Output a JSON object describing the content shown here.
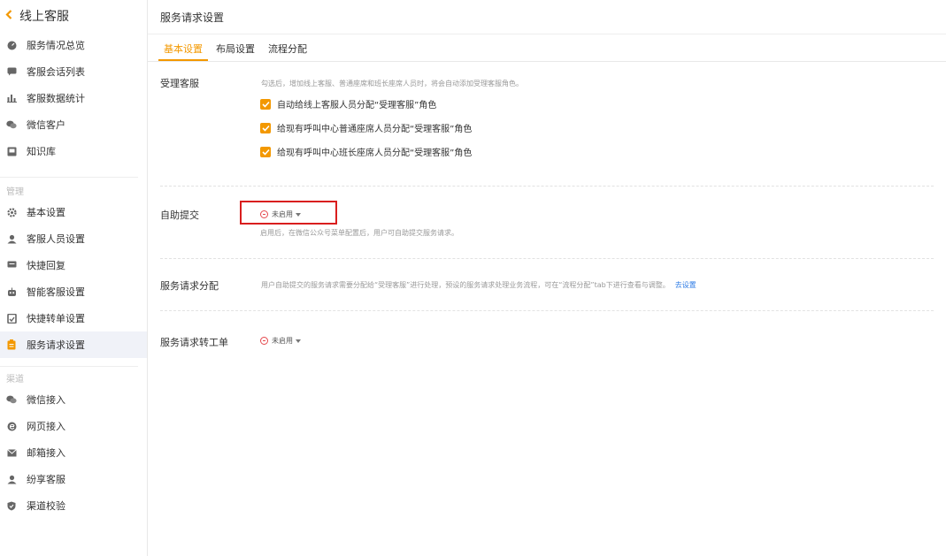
{
  "sidebar": {
    "back_icon": "chevron-left-icon",
    "title": "线上客服",
    "group1": [
      {
        "label": "服务情况总览",
        "icon": "gauge-icon"
      },
      {
        "label": "客服会话列表",
        "icon": "chat-icon"
      },
      {
        "label": "客服数据统计",
        "icon": "bar-chart-icon"
      },
      {
        "label": "微信客户",
        "icon": "wechat-icon"
      },
      {
        "label": "知识库",
        "icon": "book-icon"
      }
    ],
    "section_manage": "管理",
    "group2": [
      {
        "label": "基本设置",
        "icon": "gear-icon"
      },
      {
        "label": "客服人员设置",
        "icon": "agent-icon"
      },
      {
        "label": "快捷回复",
        "icon": "message-icon"
      },
      {
        "label": "智能客服设置",
        "icon": "robot-icon"
      },
      {
        "label": "快捷转单设置",
        "icon": "transfer-icon"
      },
      {
        "label": "服务请求设置",
        "icon": "clipboard-icon",
        "active": true
      }
    ],
    "section_channel": "渠道",
    "group3": [
      {
        "label": "微信接入",
        "icon": "wechat-icon"
      },
      {
        "label": "网页接入",
        "icon": "browser-icon"
      },
      {
        "label": "邮箱接入",
        "icon": "mail-icon"
      },
      {
        "label": "纷享客服",
        "icon": "agent-icon"
      },
      {
        "label": "渠道校验",
        "icon": "shield-icon"
      }
    ]
  },
  "header": {
    "title": "服务请求设置"
  },
  "tabs": [
    {
      "label": "基本设置",
      "active": true
    },
    {
      "label": "布局设置"
    },
    {
      "label": "流程分配"
    }
  ],
  "sections": {
    "accept": {
      "label": "受理客服",
      "desc": "勾选后，增加线上客服、普通座席和班长座席人员时，将会自动添加受理客服角色。",
      "options": [
        "自动给线上客服人员分配“受理客服”角色",
        "给现有呼叫中心普通座席人员分配“受理客服”角色",
        "给现有呼叫中心班长座席人员分配“受理客服”角色"
      ]
    },
    "self_submit": {
      "label": "自助提交",
      "status": "未启用",
      "desc": "启用后，在微信公众号菜单配置后，用户可自助提交服务请求。"
    },
    "dispatch": {
      "label": "服务请求分配",
      "desc": "用户自助提交的服务请求需要分配给“受理客服”进行处理，预设的服务请求处理业务流程，可在“流程分配”tab下进行查看与调整。",
      "link": "去设置"
    },
    "to_ticket": {
      "label": "服务请求转工单",
      "status": "未启用"
    }
  },
  "colors": {
    "accent": "#f39800",
    "danger": "#e5484d",
    "link": "#2d7be5",
    "highlight": "#d91e1e"
  }
}
